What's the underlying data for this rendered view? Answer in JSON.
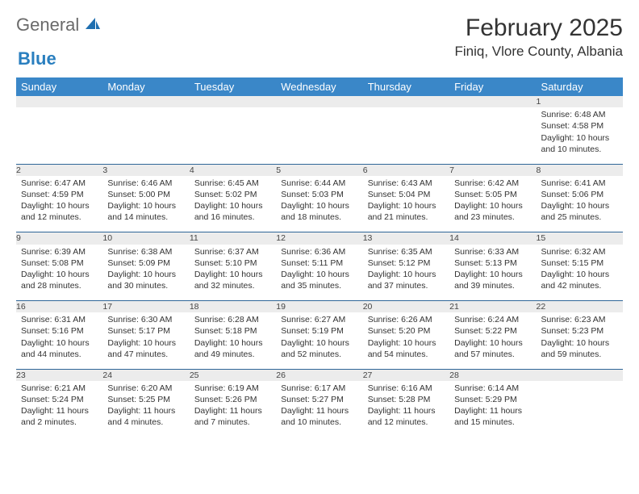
{
  "logo": {
    "word1": "General",
    "word2": "Blue"
  },
  "title": "February 2025",
  "location": "Finiq, Vlore County, Albania",
  "weekdays": [
    "Sunday",
    "Monday",
    "Tuesday",
    "Wednesday",
    "Thursday",
    "Friday",
    "Saturday"
  ],
  "weeks": [
    [
      null,
      null,
      null,
      null,
      null,
      null,
      {
        "n": "1",
        "sr": "Sunrise: 6:48 AM",
        "ss": "Sunset: 4:58 PM",
        "dl": "Daylight: 10 hours and 10 minutes."
      }
    ],
    [
      {
        "n": "2",
        "sr": "Sunrise: 6:47 AM",
        "ss": "Sunset: 4:59 PM",
        "dl": "Daylight: 10 hours and 12 minutes."
      },
      {
        "n": "3",
        "sr": "Sunrise: 6:46 AM",
        "ss": "Sunset: 5:00 PM",
        "dl": "Daylight: 10 hours and 14 minutes."
      },
      {
        "n": "4",
        "sr": "Sunrise: 6:45 AM",
        "ss": "Sunset: 5:02 PM",
        "dl": "Daylight: 10 hours and 16 minutes."
      },
      {
        "n": "5",
        "sr": "Sunrise: 6:44 AM",
        "ss": "Sunset: 5:03 PM",
        "dl": "Daylight: 10 hours and 18 minutes."
      },
      {
        "n": "6",
        "sr": "Sunrise: 6:43 AM",
        "ss": "Sunset: 5:04 PM",
        "dl": "Daylight: 10 hours and 21 minutes."
      },
      {
        "n": "7",
        "sr": "Sunrise: 6:42 AM",
        "ss": "Sunset: 5:05 PM",
        "dl": "Daylight: 10 hours and 23 minutes."
      },
      {
        "n": "8",
        "sr": "Sunrise: 6:41 AM",
        "ss": "Sunset: 5:06 PM",
        "dl": "Daylight: 10 hours and 25 minutes."
      }
    ],
    [
      {
        "n": "9",
        "sr": "Sunrise: 6:39 AM",
        "ss": "Sunset: 5:08 PM",
        "dl": "Daylight: 10 hours and 28 minutes."
      },
      {
        "n": "10",
        "sr": "Sunrise: 6:38 AM",
        "ss": "Sunset: 5:09 PM",
        "dl": "Daylight: 10 hours and 30 minutes."
      },
      {
        "n": "11",
        "sr": "Sunrise: 6:37 AM",
        "ss": "Sunset: 5:10 PM",
        "dl": "Daylight: 10 hours and 32 minutes."
      },
      {
        "n": "12",
        "sr": "Sunrise: 6:36 AM",
        "ss": "Sunset: 5:11 PM",
        "dl": "Daylight: 10 hours and 35 minutes."
      },
      {
        "n": "13",
        "sr": "Sunrise: 6:35 AM",
        "ss": "Sunset: 5:12 PM",
        "dl": "Daylight: 10 hours and 37 minutes."
      },
      {
        "n": "14",
        "sr": "Sunrise: 6:33 AM",
        "ss": "Sunset: 5:13 PM",
        "dl": "Daylight: 10 hours and 39 minutes."
      },
      {
        "n": "15",
        "sr": "Sunrise: 6:32 AM",
        "ss": "Sunset: 5:15 PM",
        "dl": "Daylight: 10 hours and 42 minutes."
      }
    ],
    [
      {
        "n": "16",
        "sr": "Sunrise: 6:31 AM",
        "ss": "Sunset: 5:16 PM",
        "dl": "Daylight: 10 hours and 44 minutes."
      },
      {
        "n": "17",
        "sr": "Sunrise: 6:30 AM",
        "ss": "Sunset: 5:17 PM",
        "dl": "Daylight: 10 hours and 47 minutes."
      },
      {
        "n": "18",
        "sr": "Sunrise: 6:28 AM",
        "ss": "Sunset: 5:18 PM",
        "dl": "Daylight: 10 hours and 49 minutes."
      },
      {
        "n": "19",
        "sr": "Sunrise: 6:27 AM",
        "ss": "Sunset: 5:19 PM",
        "dl": "Daylight: 10 hours and 52 minutes."
      },
      {
        "n": "20",
        "sr": "Sunrise: 6:26 AM",
        "ss": "Sunset: 5:20 PM",
        "dl": "Daylight: 10 hours and 54 minutes."
      },
      {
        "n": "21",
        "sr": "Sunrise: 6:24 AM",
        "ss": "Sunset: 5:22 PM",
        "dl": "Daylight: 10 hours and 57 minutes."
      },
      {
        "n": "22",
        "sr": "Sunrise: 6:23 AM",
        "ss": "Sunset: 5:23 PM",
        "dl": "Daylight: 10 hours and 59 minutes."
      }
    ],
    [
      {
        "n": "23",
        "sr": "Sunrise: 6:21 AM",
        "ss": "Sunset: 5:24 PM",
        "dl": "Daylight: 11 hours and 2 minutes."
      },
      {
        "n": "24",
        "sr": "Sunrise: 6:20 AM",
        "ss": "Sunset: 5:25 PM",
        "dl": "Daylight: 11 hours and 4 minutes."
      },
      {
        "n": "25",
        "sr": "Sunrise: 6:19 AM",
        "ss": "Sunset: 5:26 PM",
        "dl": "Daylight: 11 hours and 7 minutes."
      },
      {
        "n": "26",
        "sr": "Sunrise: 6:17 AM",
        "ss": "Sunset: 5:27 PM",
        "dl": "Daylight: 11 hours and 10 minutes."
      },
      {
        "n": "27",
        "sr": "Sunrise: 6:16 AM",
        "ss": "Sunset: 5:28 PM",
        "dl": "Daylight: 11 hours and 12 minutes."
      },
      {
        "n": "28",
        "sr": "Sunrise: 6:14 AM",
        "ss": "Sunset: 5:29 PM",
        "dl": "Daylight: 11 hours and 15 minutes."
      },
      null
    ]
  ]
}
